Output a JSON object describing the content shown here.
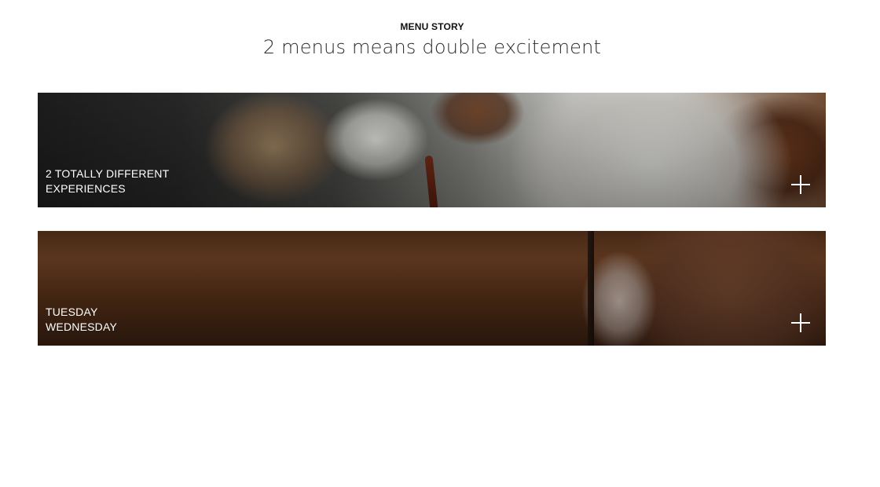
{
  "section": {
    "eyebrow": "MENU STORY",
    "headline": "2 menus means double excitement"
  },
  "panels": [
    {
      "label_lines": [
        "2 TOTALLY DIFFERENT",
        "EXPERIENCES"
      ],
      "icon": "plus-icon",
      "image": "tea-pouring-photo"
    },
    {
      "label_lines": [
        "TUESDAY",
        "WEDNESDAY"
      ],
      "icon": "plus-icon",
      "image": "rolling-pin-hand-photo"
    }
  ],
  "colors": {
    "background": "#ffffff",
    "headline_text": "#2b2b2b",
    "eyebrow_text": "#111111",
    "panel_text": "#ffffff"
  }
}
